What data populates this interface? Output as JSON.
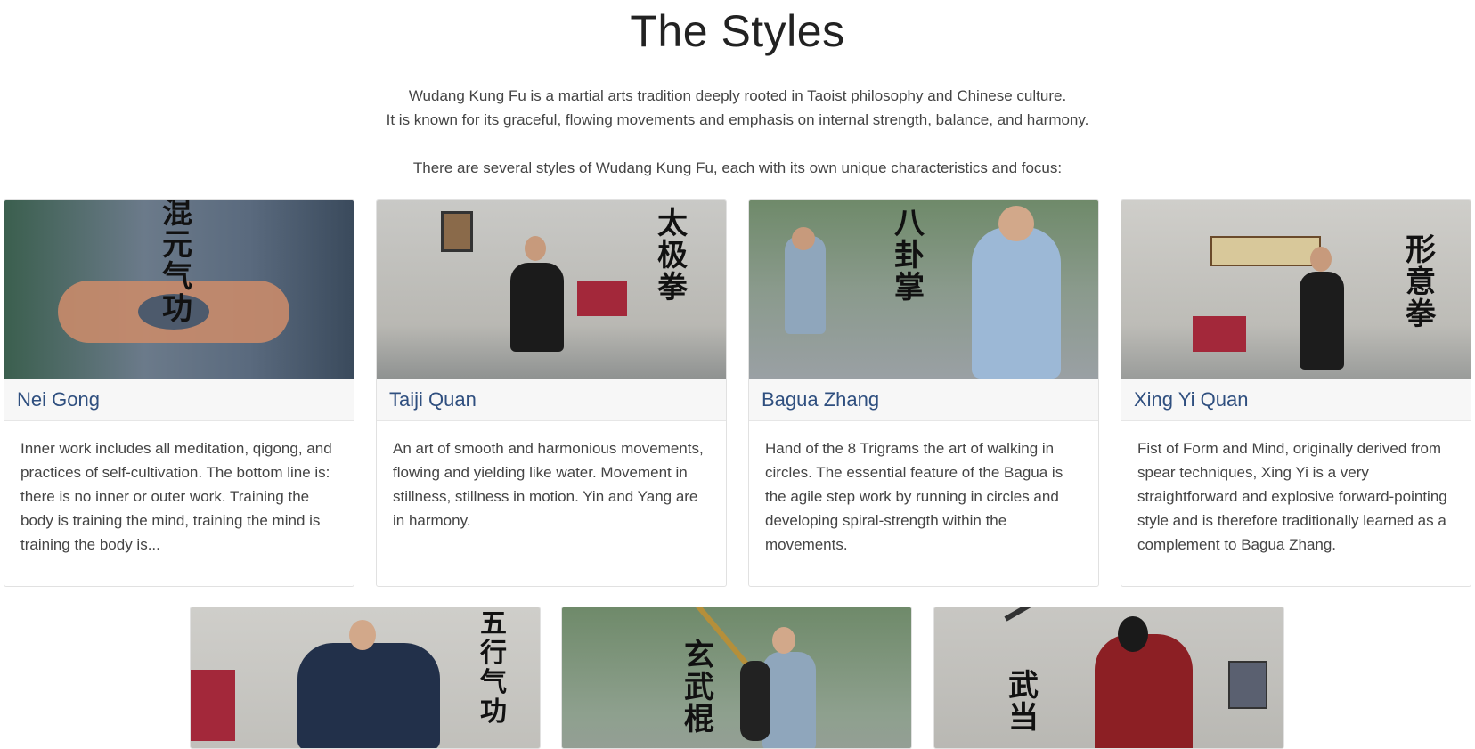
{
  "page": {
    "title": "The Styles",
    "intro_line1": "Wudang Kung Fu is a martial arts tradition deeply rooted in Taoist philosophy and Chinese culture.",
    "intro_line2": "It is known for its graceful, flowing movements and emphasis on internal strength, balance, and harmony.",
    "intro_line3": "There are several styles of Wudang Kung Fu, each with its own unique characteristics and focus:"
  },
  "cards": [
    {
      "title": "Nei Gong",
      "glyphs": "混元气功",
      "text": "Inner work includes all meditation, qigong, and practices of self-cultivation. The bottom line is: there is no inner or outer work. Training the body is training the mind, training the mind is training the body is..."
    },
    {
      "title": "Taiji Quan",
      "glyphs": "太极拳",
      "text": "An art of smooth and harmonious movements, flowing and yielding like water. Movement in stillness, stillness in motion. Yin and Yang are in harmony."
    },
    {
      "title": "Bagua Zhang",
      "glyphs": "八卦掌",
      "text": "Hand of the 8 Trigrams the art of walking in circles. The essential feature of the Bagua is the agile step work by running in circles and developing spiral-strength within the movements."
    },
    {
      "title": "Xing Yi Quan",
      "glyphs": "形意拳",
      "text": "Fist of Form and Mind, originally derived from spear techniques, Xing Yi is a very straightforward and explosive forward-pointing style and is therefore traditionally learned as a complement to Bagua Zhang."
    },
    {
      "glyphs": "五行气功"
    },
    {
      "glyphs": "玄武棍"
    },
    {
      "glyphs": "武当"
    }
  ]
}
